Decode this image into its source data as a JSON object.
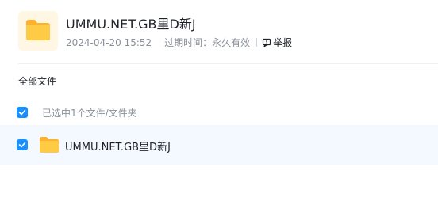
{
  "share": {
    "title": "UMMU.NET.GB里D新J",
    "date": "2024-04-20 15:52",
    "expire_label": "过期时间：永久有效",
    "report_label": "举报"
  },
  "breadcrumb": {
    "label": "全部文件"
  },
  "selection": {
    "text": "已选中1个文件/文件夹"
  },
  "files": [
    {
      "name": "UMMU.NET.GB里D新J",
      "selected": true,
      "icon": "folder-icon"
    }
  ],
  "colors": {
    "accent": "#1890ff",
    "folder": "#ffc53d",
    "selected_row_bg": "#f4f9ff"
  }
}
